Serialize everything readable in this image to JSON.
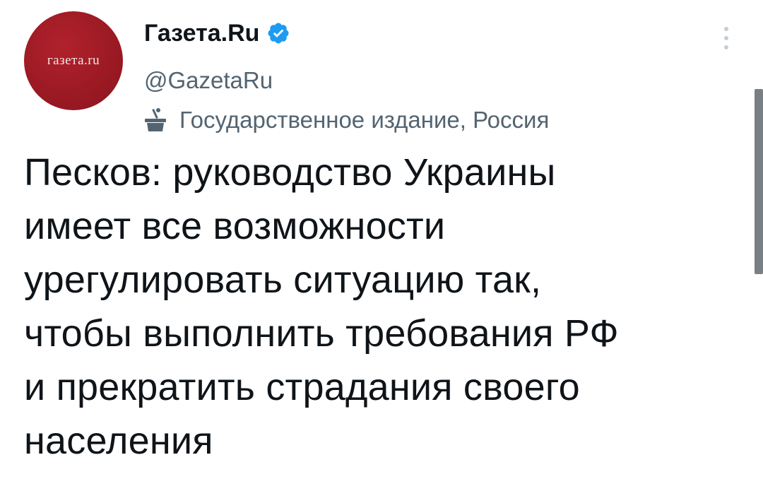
{
  "account": {
    "avatar_text": "газета.ru",
    "display_name": "Газета.Ru",
    "handle": "@GazetaRu",
    "verified_color": "#1d9bf0",
    "verified_icon": "verified-badge-icon",
    "label_icon": "government-podium-icon",
    "label_text": "Государственное издание, Россия"
  },
  "menu": {
    "icon": "more-vertical-icon"
  },
  "tweet": {
    "lines": [
      "Песков: руководство Украины",
      "имеет все возможности",
      "урегулировать ситуацию так,",
      "чтобы выполнить требования РФ",
      "и прекратить страдания своего",
      "населения"
    ]
  },
  "colors": {
    "avatar_bg": "#9c1a24",
    "secondary_text": "#536471",
    "primary_text": "#0f1419"
  }
}
